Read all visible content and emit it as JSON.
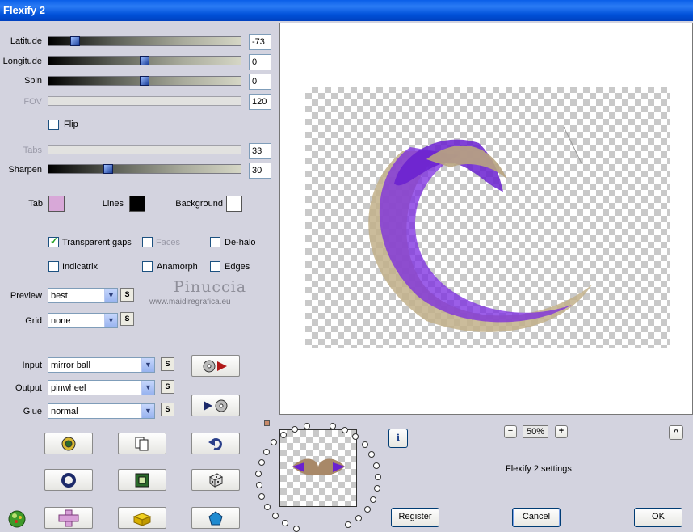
{
  "window": {
    "title": "Flexify 2"
  },
  "params": {
    "latitude": {
      "label": "Latitude",
      "value": "-73",
      "fraction": 0.12
    },
    "longitude": {
      "label": "Longitude",
      "value": "0",
      "fraction": 0.5
    },
    "spin": {
      "label": "Spin",
      "value": "0",
      "fraction": 0.5
    },
    "fov": {
      "label": "FOV",
      "value": "120"
    },
    "flip": {
      "label": "Flip",
      "checked": false
    },
    "tabs": {
      "label": "Tabs",
      "value": "33"
    },
    "sharpen": {
      "label": "Sharpen",
      "value": "30",
      "fraction": 0.3
    }
  },
  "colors": {
    "tab": {
      "label": "Tab",
      "color": "#d8a8d8"
    },
    "lines": {
      "label": "Lines",
      "color": "#000000"
    },
    "background": {
      "label": "Background",
      "color": "#ffffff"
    }
  },
  "options": {
    "transparent_gaps": {
      "label": "Transparent gaps",
      "checked": true
    },
    "faces": {
      "label": "Faces",
      "checked": false
    },
    "de_halo": {
      "label": "De-halo",
      "checked": false
    },
    "indicatrix": {
      "label": "Indicatrix",
      "checked": false
    },
    "anamorph": {
      "label": "Anamorph",
      "checked": false
    },
    "edges": {
      "label": "Edges",
      "checked": false
    }
  },
  "selects": {
    "preview": {
      "label": "Preview",
      "value": "best"
    },
    "grid": {
      "label": "Grid",
      "value": "none"
    },
    "input": {
      "label": "Input",
      "value": "mirror ball"
    },
    "output": {
      "label": "Output",
      "value": "pinwheel"
    },
    "glue": {
      "label": "Glue",
      "value": "normal"
    }
  },
  "s_label": "S",
  "watermark": {
    "name": "Pinuccia",
    "url": "www.maidiregrafica.eu"
  },
  "zoom": {
    "value": "50%",
    "minus": "−",
    "plus": "+"
  },
  "status_text": "Flexify 2 settings",
  "info_label": "i",
  "collapse_label": "^",
  "buttons": {
    "register": "Register",
    "cancel": "Cancel",
    "ok": "OK"
  }
}
